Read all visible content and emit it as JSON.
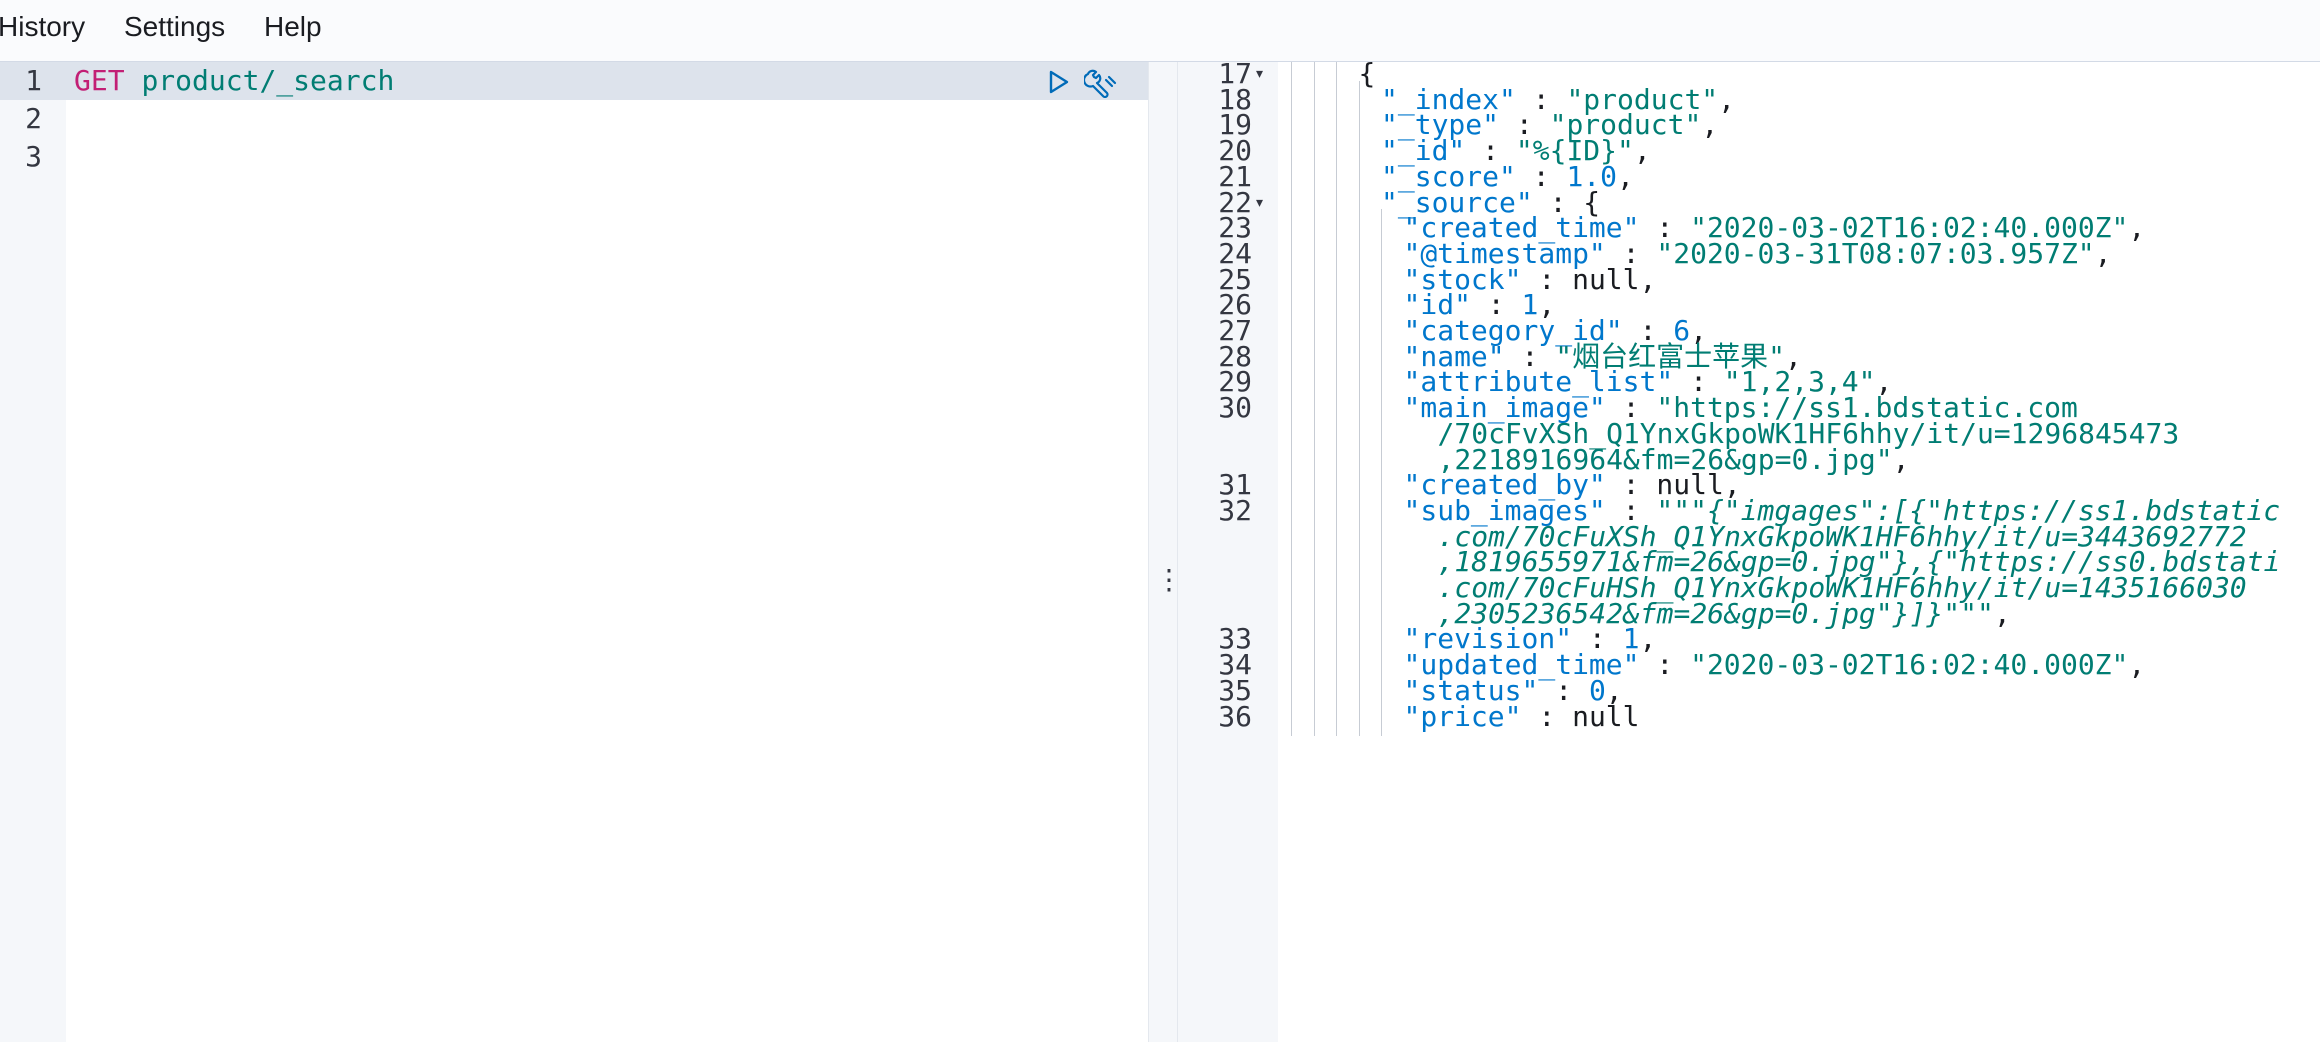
{
  "menu": {
    "history": "History",
    "settings": "Settings",
    "help": "Help"
  },
  "request": {
    "line_numbers": [
      "1",
      "2",
      "3"
    ],
    "method": "GET",
    "path": "product/_search",
    "run_icon": "play-icon",
    "settings_icon": "wrench-icon"
  },
  "response": {
    "lines": [
      {
        "ln": "17",
        "fold": "▾",
        "depth": 3,
        "parts": [
          [
            "p",
            "{"
          ]
        ]
      },
      {
        "ln": "18",
        "depth": 4,
        "parts": [
          [
            "k",
            "\"_index\""
          ],
          [
            "p",
            " : "
          ],
          [
            "s",
            "\"product\""
          ],
          [
            "p",
            ","
          ]
        ]
      },
      {
        "ln": "19",
        "depth": 4,
        "parts": [
          [
            "k",
            "\"_type\""
          ],
          [
            "p",
            " : "
          ],
          [
            "s",
            "\"product\""
          ],
          [
            "p",
            ","
          ]
        ]
      },
      {
        "ln": "20",
        "depth": 4,
        "parts": [
          [
            "k",
            "\"_id\""
          ],
          [
            "p",
            " : "
          ],
          [
            "s",
            "\"%{ID}\""
          ],
          [
            "p",
            ","
          ]
        ]
      },
      {
        "ln": "21",
        "depth": 4,
        "parts": [
          [
            "k",
            "\"_score\""
          ],
          [
            "p",
            " : "
          ],
          [
            "n",
            "1.0"
          ],
          [
            "p",
            ","
          ]
        ]
      },
      {
        "ln": "22",
        "fold": "▾",
        "depth": 4,
        "parts": [
          [
            "k",
            "\"_source\""
          ],
          [
            "p",
            " : {"
          ]
        ]
      },
      {
        "ln": "23",
        "depth": 5,
        "parts": [
          [
            "k",
            "\"created_time\""
          ],
          [
            "p",
            " : "
          ],
          [
            "s",
            "\"2020-03-02T16:02:40.000Z\""
          ],
          [
            "p",
            ","
          ]
        ]
      },
      {
        "ln": "24",
        "depth": 5,
        "parts": [
          [
            "k",
            "\"@timestamp\""
          ],
          [
            "p",
            " : "
          ],
          [
            "s",
            "\"2020-03-31T08:07:03.957Z\""
          ],
          [
            "p",
            ","
          ]
        ]
      },
      {
        "ln": "25",
        "depth": 5,
        "parts": [
          [
            "k",
            "\"stock\""
          ],
          [
            "p",
            " : "
          ],
          [
            "t",
            "null"
          ],
          [
            "p",
            ","
          ]
        ]
      },
      {
        "ln": "26",
        "depth": 5,
        "parts": [
          [
            "k",
            "\"id\""
          ],
          [
            "p",
            " : "
          ],
          [
            "n",
            "1"
          ],
          [
            "p",
            ","
          ]
        ]
      },
      {
        "ln": "27",
        "depth": 5,
        "parts": [
          [
            "k",
            "\"category_id\""
          ],
          [
            "p",
            " : "
          ],
          [
            "n",
            "6"
          ],
          [
            "p",
            ","
          ]
        ]
      },
      {
        "ln": "28",
        "depth": 5,
        "parts": [
          [
            "k",
            "\"name\""
          ],
          [
            "p",
            " : "
          ],
          [
            "s",
            "\"烟台红富士苹果\""
          ],
          [
            "p",
            ","
          ]
        ]
      },
      {
        "ln": "29",
        "depth": 5,
        "parts": [
          [
            "k",
            "\"attribute_list\""
          ],
          [
            "p",
            " : "
          ],
          [
            "s",
            "\"1,2,3,4\""
          ],
          [
            "p",
            ","
          ]
        ]
      },
      {
        "ln": "30",
        "depth": 5,
        "parts": [
          [
            "k",
            "\"main_image\""
          ],
          [
            "p",
            " : "
          ],
          [
            "s",
            "\"https://ss1.bdstatic.com"
          ]
        ]
      },
      {
        "ln": "",
        "depth": 5,
        "indent": 1,
        "parts": [
          [
            "s",
            "/70cFvXSh_Q1YnxGkpoWK1HF6hhy/it/u=1296845473"
          ]
        ]
      },
      {
        "ln": "",
        "depth": 5,
        "indent": 1,
        "parts": [
          [
            "s",
            ",2218916964&fm=26&gp=0.jpg\""
          ],
          [
            "p",
            ","
          ]
        ]
      },
      {
        "ln": "31",
        "depth": 5,
        "parts": [
          [
            "k",
            "\"created_by\""
          ],
          [
            "p",
            " : "
          ],
          [
            "t",
            "null"
          ],
          [
            "p",
            ","
          ]
        ]
      },
      {
        "ln": "32",
        "depth": 5,
        "parts": [
          [
            "k",
            "\"sub_images\""
          ],
          [
            "p",
            " : "
          ],
          [
            "s",
            "\"\"\""
          ],
          [
            "it",
            "{\"imgages\":[{\"https://ss1.bdstatic"
          ]
        ]
      },
      {
        "ln": "",
        "depth": 5,
        "indent": 1,
        "parts": [
          [
            "it",
            ".com/70cFuXSh_Q1YnxGkpoWK1HF6hhy/it/u=3443692772"
          ]
        ]
      },
      {
        "ln": "",
        "depth": 5,
        "indent": 1,
        "parts": [
          [
            "it",
            ",1819655971&fm=26&gp=0.jpg\"},{\"https://ss0.bdstati"
          ]
        ]
      },
      {
        "ln": "",
        "depth": 5,
        "indent": 1,
        "parts": [
          [
            "it",
            ".com/70cFuHSh_Q1YnxGkpoWK1HF6hhy/it/u=1435166030"
          ]
        ]
      },
      {
        "ln": "",
        "depth": 5,
        "indent": 1,
        "parts": [
          [
            "it",
            ",2305236542&fm=26&gp=0.jpg\"}]}"
          ],
          [
            "s",
            "\"\"\""
          ],
          [
            "p",
            ","
          ]
        ]
      },
      {
        "ln": "33",
        "depth": 5,
        "parts": [
          [
            "k",
            "\"revision\""
          ],
          [
            "p",
            " : "
          ],
          [
            "n",
            "1"
          ],
          [
            "p",
            ","
          ]
        ]
      },
      {
        "ln": "34",
        "depth": 5,
        "parts": [
          [
            "k",
            "\"updated_time\""
          ],
          [
            "p",
            " : "
          ],
          [
            "s",
            "\"2020-03-02T16:02:40.000Z\""
          ],
          [
            "p",
            ","
          ]
        ]
      },
      {
        "ln": "35",
        "depth": 5,
        "parts": [
          [
            "k",
            "\"status\""
          ],
          [
            "p",
            " : "
          ],
          [
            "n",
            "0"
          ],
          [
            "p",
            ","
          ]
        ]
      },
      {
        "ln": "36",
        "depth": 5,
        "parts": [
          [
            "k",
            "\"price\""
          ],
          [
            "p",
            " : "
          ],
          [
            "t",
            "null"
          ]
        ]
      }
    ]
  },
  "divider": {
    "handle_glyph": "⋮"
  }
}
